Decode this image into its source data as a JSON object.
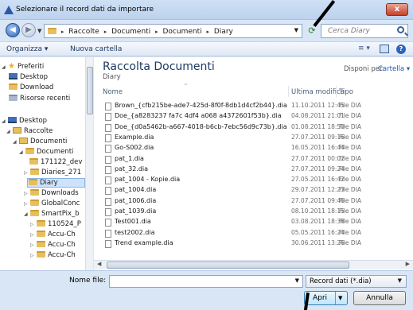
{
  "window": {
    "title": "Selezionare il record dati da importare",
    "close_label": "x"
  },
  "address": {
    "crumbs": [
      "Raccolte",
      "Documenti",
      "Documenti",
      "Diary"
    ],
    "search_placeholder": "Cerca Diary"
  },
  "toolbar": {
    "organize_label": "Organizza ▾",
    "new_folder_label": "Nuova cartella",
    "view_label": "≡ ▾",
    "help_label": "?"
  },
  "nav": {
    "items": [
      {
        "label": "Preferiti",
        "icon": "star-icon"
      },
      {
        "label": "Desktop",
        "icon": "desktop-icon"
      },
      {
        "label": "Download",
        "icon": "folder-icon"
      },
      {
        "label": "Risorse recenti",
        "icon": "recent-places-icon"
      },
      {
        "label": "Desktop",
        "icon": "desktop-icon"
      },
      {
        "label": "Raccolte",
        "icon": "library-icon"
      },
      {
        "label": "Documenti",
        "icon": "library-icon"
      },
      {
        "label": "Documenti",
        "icon": "folder-icon"
      },
      {
        "label": "171122_dev",
        "icon": "folder-icon"
      },
      {
        "label": "Diaries_271",
        "icon": "folder-icon"
      },
      {
        "label": "Diary",
        "icon": "folder-icon",
        "selected": true
      },
      {
        "label": "Downloads",
        "icon": "folder-icon"
      },
      {
        "label": "GlobalConc",
        "icon": "folder-icon"
      },
      {
        "label": "SmartPix_b",
        "icon": "folder-icon"
      },
      {
        "label": "110524_P",
        "icon": "folder-icon"
      },
      {
        "label": "Accu-Ch",
        "icon": "folder-icon"
      },
      {
        "label": "Accu-Ch",
        "icon": "folder-icon"
      },
      {
        "label": "Accu-Ch",
        "icon": "folder-icon"
      }
    ]
  },
  "content": {
    "library_title": "Raccolta Documenti",
    "library_subtitle": "Diary",
    "arrange_label": "Disponi per:",
    "arrange_value": "Cartella ▾",
    "columns": {
      "name": "Nome",
      "date": "Ultima modifica",
      "type": "Tipo"
    },
    "files": [
      {
        "name": "Brown_{cfb215be-ade7-425d-8f0f-8db1d4cf2b44}.dia",
        "date": "11.10.2011 12:45",
        "type": "File DIA"
      },
      {
        "name": "Doe_{a8283237 fa7c 4df4 a068 a4372601f53b}.dia",
        "date": "04.08.2011 21:01",
        "type": "File DIA"
      },
      {
        "name": "Doe_{d0a5462b-a667-4018-b6cb-7ebc56d9c73b}.dia",
        "date": "01.08.2011 18:50",
        "type": "File DIA"
      },
      {
        "name": "Example.dia",
        "date": "27.07.2011 09:16",
        "type": "File DIA"
      },
      {
        "name": "Go-S002.dia",
        "date": "16.05.2011 16:44",
        "type": "File DIA"
      },
      {
        "name": "pat_1.dia",
        "date": "27.07.2011 00:02",
        "type": "File DIA"
      },
      {
        "name": "pat_32.dia",
        "date": "27.07.2011 09:24",
        "type": "File DIA"
      },
      {
        "name": "pat_1004 - Kopie.dia",
        "date": "27.05.2011 16:42",
        "type": "File DIA"
      },
      {
        "name": "pat_1004.dia",
        "date": "29.07.2011 12:23",
        "type": "File DIA"
      },
      {
        "name": "pat_1006.dia",
        "date": "27.07.2011 09:46",
        "type": "File DIA"
      },
      {
        "name": "pat_1039.dia",
        "date": "08.10.2011 18:15",
        "type": "File DIA"
      },
      {
        "name": "Test001.dia",
        "date": "03.08.2011 18:38",
        "type": "File DIA"
      },
      {
        "name": "test2002.dia",
        "date": "05.05.2011 16:24",
        "type": "File DIA"
      },
      {
        "name": "Trend example.dia",
        "date": "30.06.2011 13:26",
        "type": "File DIA"
      }
    ]
  },
  "bottom": {
    "filename_label": "Nome file:",
    "filename_value": "",
    "filetype_value": "Record dati (*.dia)",
    "open_label": "Apri",
    "cancel_label": "Annulla"
  }
}
